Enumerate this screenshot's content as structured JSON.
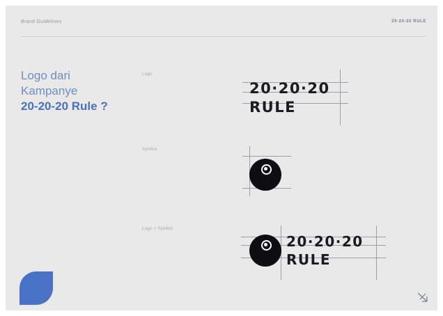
{
  "header": {
    "left_text": "Brand Guidelines",
    "right_text": "20-20-20 RULE"
  },
  "title": {
    "line1": "Logo dari",
    "line2": "Kampanye",
    "line3": "20-20-20 Rule ?"
  },
  "sections": {
    "logo_label": "Logo",
    "symbol_label": "Symbol",
    "logo_symbol_label": "Logo + Symbol"
  },
  "wordmark": {
    "line1": "20·20·20",
    "line2": "RULE"
  },
  "colors": {
    "accent": "#4a72c4",
    "title_light": "#6f8fbf",
    "symbol": "#0e0e12",
    "background": "#e9e9e9"
  },
  "icons": {
    "corner": "arrow-cross-icon",
    "decor": "leaf-shape"
  }
}
